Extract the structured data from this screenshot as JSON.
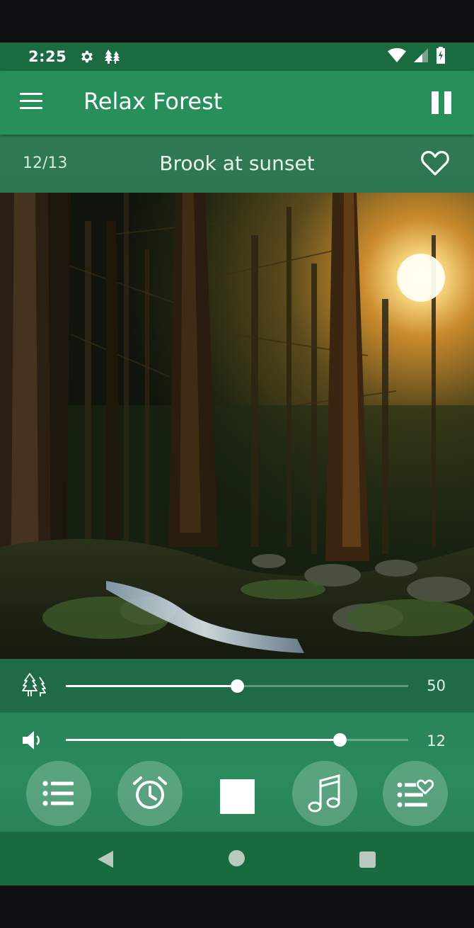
{
  "status_bar": {
    "time": "2:25",
    "icons": [
      "gear-icon",
      "trees-icon",
      "wifi-icon",
      "signal-icon",
      "battery-charging-icon"
    ]
  },
  "app_bar": {
    "title": "Relax Forest",
    "menu_icon": "hamburger-menu-icon",
    "action_icon": "pause-icon"
  },
  "track": {
    "counter": "12/13",
    "name": "Brook at sunset",
    "favorite_icon": "heart-outline-icon"
  },
  "artwork": {
    "description_icon": "forest-photo"
  },
  "sliders": [
    {
      "icon": "trees-icon",
      "value": "50",
      "fraction": 0.5
    },
    {
      "icon": "volume-icon",
      "value": "12",
      "fraction": 0.8
    }
  ],
  "controls": [
    {
      "icon": "list-icon"
    },
    {
      "icon": "alarm-clock-icon"
    },
    {
      "icon": "stop-icon"
    },
    {
      "icon": "music-note-icon"
    },
    {
      "icon": "favorites-list-icon"
    }
  ],
  "nav_bar": {
    "icons": [
      "back-triangle-icon",
      "home-circle-icon",
      "recents-square-icon"
    ]
  },
  "colors": {
    "status_bar": "#1a6b3f",
    "app_bar": "#27905a",
    "nav_bar": "#186b3e"
  }
}
